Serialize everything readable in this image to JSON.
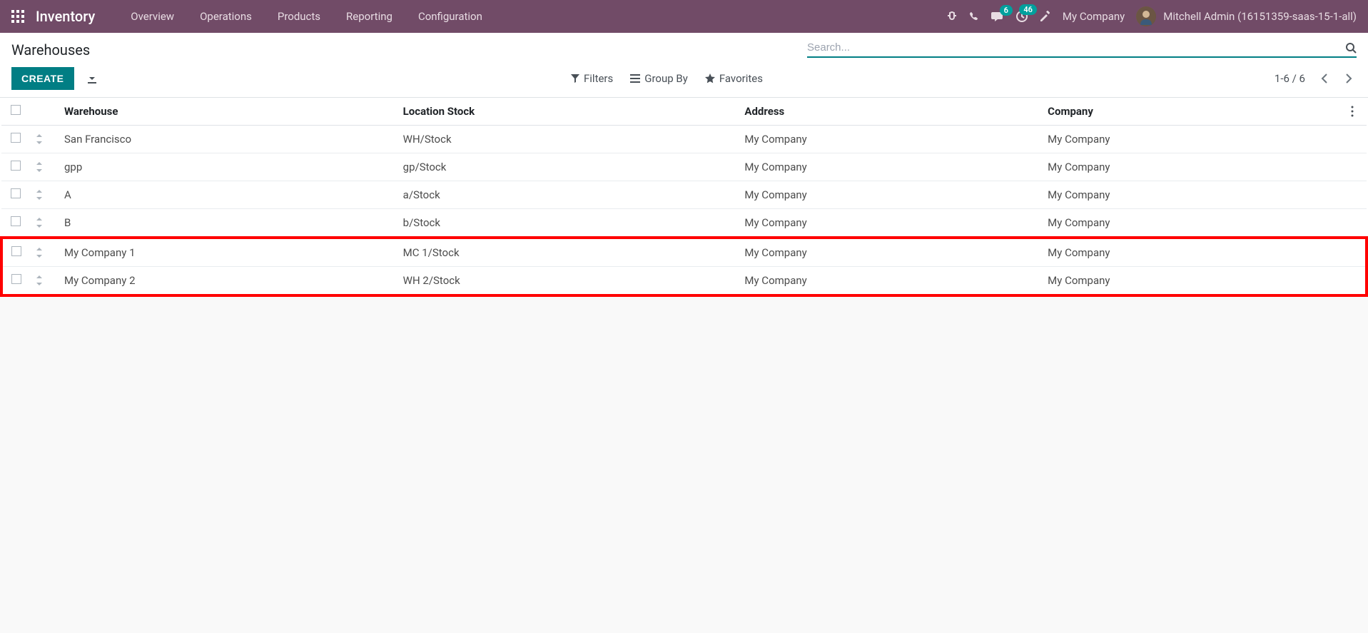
{
  "navbar": {
    "brand": "Inventory",
    "menu": [
      "Overview",
      "Operations",
      "Products",
      "Reporting",
      "Configuration"
    ],
    "messages_badge": "6",
    "activities_badge": "46",
    "company": "My Company",
    "user": "Mitchell Admin (16151359-saas-15-1-all)"
  },
  "control": {
    "breadcrumb": "Warehouses",
    "search_placeholder": "Search...",
    "create_label": "CREATE",
    "filters_label": "Filters",
    "groupby_label": "Group By",
    "favorites_label": "Favorites",
    "pager": "1-6 / 6"
  },
  "table": {
    "headers": {
      "warehouse": "Warehouse",
      "location": "Location Stock",
      "address": "Address",
      "company": "Company"
    },
    "rows": [
      {
        "warehouse": "San Francisco",
        "location": "WH/Stock",
        "address": "My Company",
        "company": "My Company",
        "highlight": false
      },
      {
        "warehouse": "gpp",
        "location": "gp/Stock",
        "address": "My Company",
        "company": "My Company",
        "highlight": false
      },
      {
        "warehouse": "A",
        "location": "a/Stock",
        "address": "My Company",
        "company": "My Company",
        "highlight": false
      },
      {
        "warehouse": "B",
        "location": "b/Stock",
        "address": "My Company",
        "company": "My Company",
        "highlight": false
      },
      {
        "warehouse": "My Company 1",
        "location": "MC 1/Stock",
        "address": "My Company",
        "company": "My Company",
        "highlight": true
      },
      {
        "warehouse": "My Company 2",
        "location": "WH 2/Stock",
        "address": "My Company",
        "company": "My Company",
        "highlight": true
      }
    ]
  }
}
